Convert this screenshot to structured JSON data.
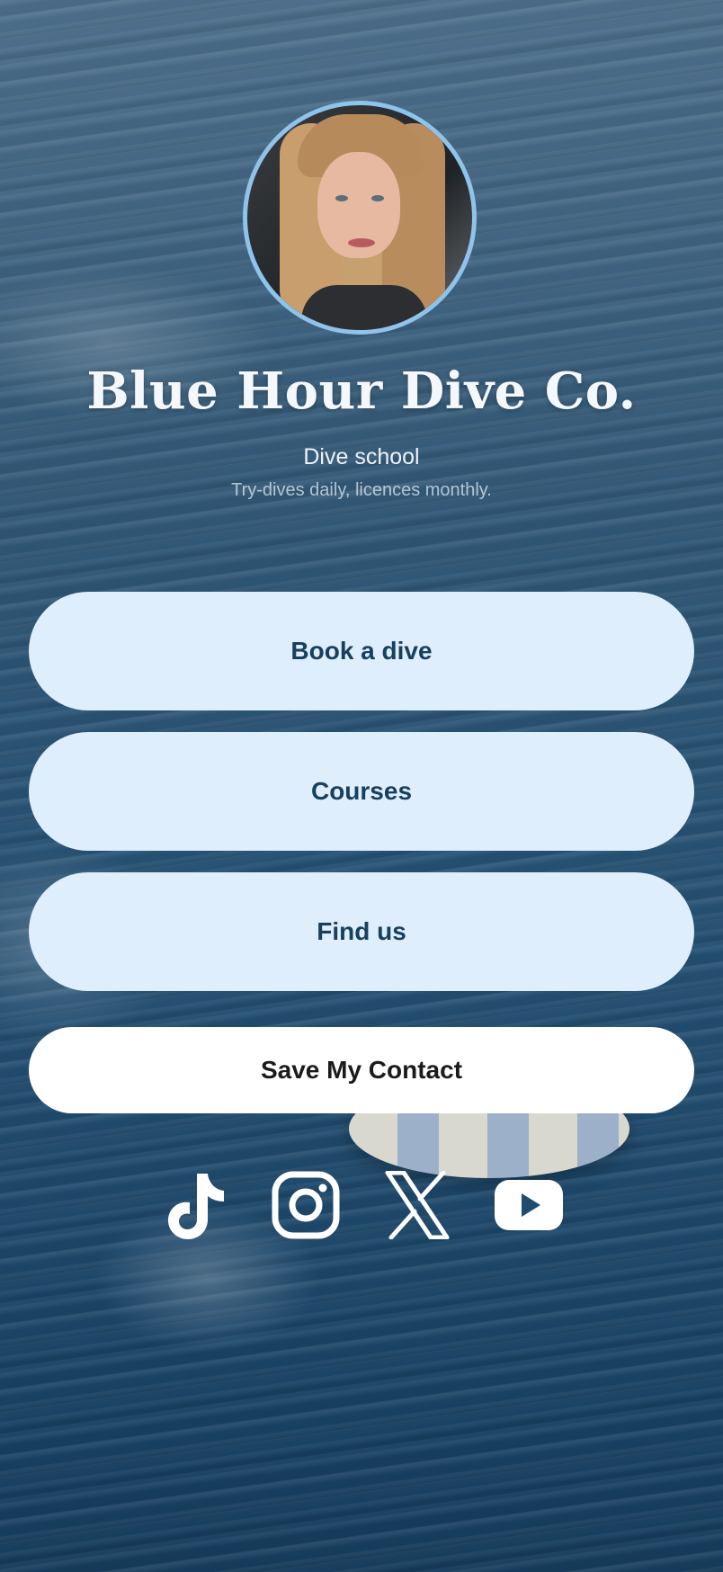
{
  "profile": {
    "name": "Blue Hour Dive Co.",
    "category": "Dive school",
    "tagline": "Try-dives daily, licences monthly."
  },
  "links": [
    {
      "label": "Book a dive"
    },
    {
      "label": "Courses"
    },
    {
      "label": "Find us"
    }
  ],
  "save_contact": {
    "label": "Save My Contact"
  },
  "socials": [
    {
      "icon": "tiktok-icon"
    },
    {
      "icon": "instagram-icon"
    },
    {
      "icon": "x-icon"
    },
    {
      "icon": "youtube-icon"
    }
  ],
  "colors": {
    "accent_border": "#8ec3ea",
    "link_button_bg": "#dfeefc",
    "link_button_text": "#17405f",
    "save_button_bg": "#ffffff"
  }
}
